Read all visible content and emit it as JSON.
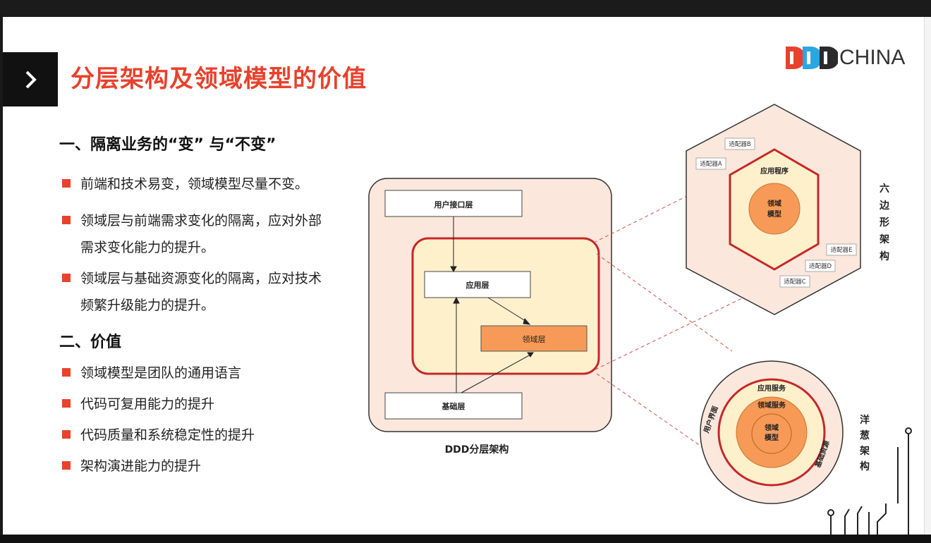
{
  "title": "分层架构及领域模型的价值",
  "logo": {
    "text": "CHINA",
    "colors": [
      "#e8412c",
      "#2aa7e0",
      "#2b2b2b"
    ]
  },
  "section1": {
    "heading": "一、隔离业务的“变” 与“不变”",
    "bullets": [
      [
        "前端和技术易变，领域模型尽量不变。"
      ],
      [
        "领域层与前端需求变化的隔离，应对外部",
        "需求变化能力的提升。"
      ],
      [
        "领域层与基础资源变化的隔离，应对技术",
        "频繁升级能力的提升。"
      ]
    ]
  },
  "section2": {
    "heading": "二、价值",
    "bullets": [
      "领域模型是团队的通用语言",
      "代码可复用能力的提升",
      "代码质量和系统稳定性的提升",
      "架构演进能力的提升"
    ]
  },
  "layered": {
    "caption": "DDD分层架构",
    "user_interface": "用户接口层",
    "application": "应用层",
    "domain": "领域层",
    "infrastructure": "基础层"
  },
  "hexagon": {
    "label": "六边形架构",
    "app": "应用程序",
    "core": "领域模型",
    "adapters": [
      "适配器A",
      "适配器B",
      "适配器C",
      "适配器D",
      "适配器E"
    ]
  },
  "onion": {
    "label": "洋葱架构",
    "app_service": "应用服务",
    "domain_service": "领域服务",
    "core": "领域模型",
    "ui": "用户界面",
    "infra": "基础资源"
  },
  "colors": {
    "accent": "#e8412c",
    "border_red": "#c62828",
    "domain_orange": "#f79a57",
    "light_yellow": "#fff0cc",
    "peach": "#fbe7dc"
  }
}
